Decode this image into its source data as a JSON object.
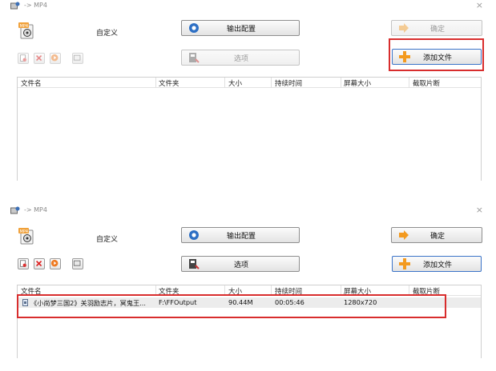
{
  "window": {
    "title": "-> MP4",
    "close": "×"
  },
  "toolbar": {
    "preset_label": "自定义",
    "output_config": "输出配置",
    "options": "选项",
    "ok": "确定",
    "add_file": "添加文件",
    "mp4_badge": "MP4"
  },
  "list": {
    "columns": [
      "文件名",
      "文件夹",
      "大小",
      "持续时间",
      "屏幕大小",
      "截取片断"
    ],
    "rows": [
      {
        "file_name": "《小尚梦三国2》关羽励志片，冥鬼王...",
        "folder": "F:\\FFOutput",
        "size": "90.44M",
        "duration": "00:05:46",
        "screen_size": "1280x720",
        "clip": ""
      }
    ]
  },
  "colors": {
    "highlight": "#d82d2d",
    "accent_orange": "#f39a1f",
    "accent_blue": "#3a73c8"
  },
  "icons": [
    "app-icon",
    "mp4-file-icon",
    "output-config-icon",
    "options-icon",
    "ok-arrow-icon",
    "add-plus-icon",
    "remove-file-icon",
    "delete-icon",
    "play-icon",
    "preview-icon",
    "video-file-icon"
  ]
}
